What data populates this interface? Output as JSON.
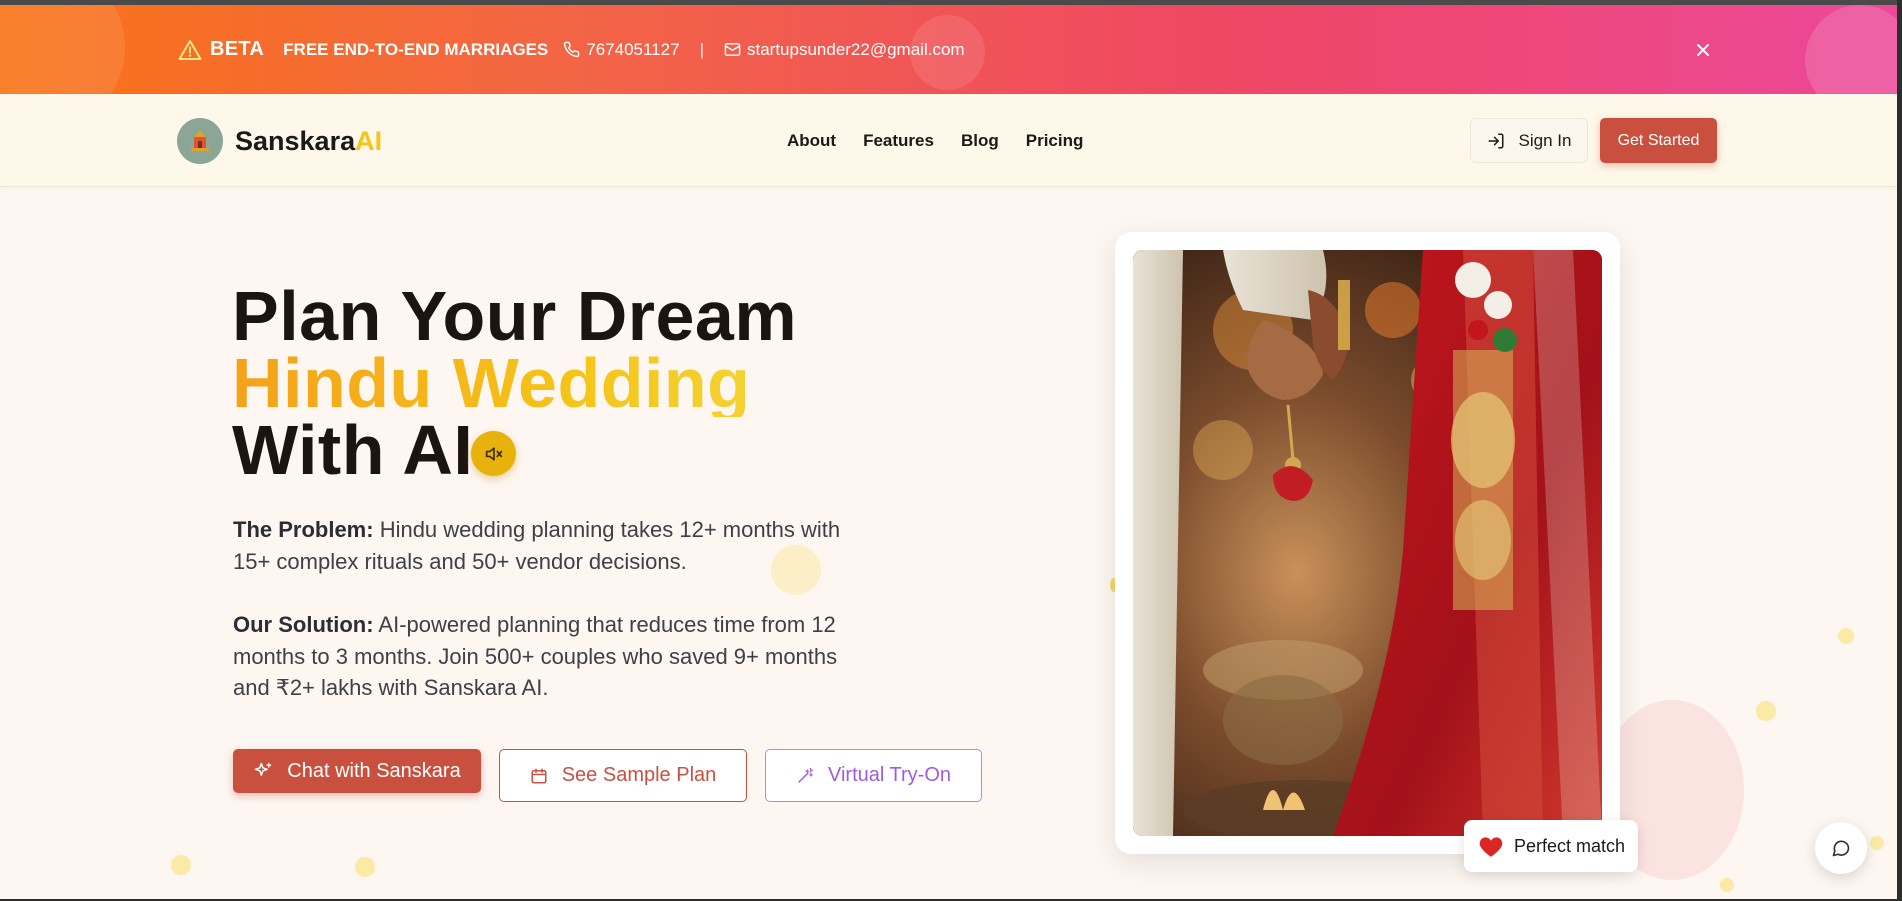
{
  "promo": {
    "beta_label": "BETA",
    "offer": "FREE END-TO-END MARRIAGES",
    "phone": "7674051127",
    "separator": "|",
    "email": "startupsunder22@gmail.com",
    "icons": [
      "warning-icon",
      "phone-icon",
      "mail-icon",
      "close-icon"
    ]
  },
  "header": {
    "brand_main": "Sanskara",
    "brand_accent": "AI",
    "nav": [
      "About",
      "Features",
      "Blog",
      "Pricing"
    ],
    "signin_label": "Sign In",
    "cta_label": "Get Started"
  },
  "hero": {
    "title_line1": "Plan Your Dream",
    "title_line2": "Hindu Wedding",
    "title_line3": "With AI",
    "problem_label": "The Problem:",
    "problem_text": " Hindu wedding planning takes 12+ months with 15+ complex rituals and 50+ vendor decisions.",
    "solution_label": "Our Solution:",
    "solution_text": " AI-powered planning that reduces time from 12 months to 3 months. Join 500+ couples who saved 9+ months and ₹2+ lakhs with Sanskara AI.",
    "btn_chat": "Chat with Sanskara",
    "btn_plan": "See Sample Plan",
    "btn_vto": "Virtual Try-On"
  },
  "badge": {
    "label": "Perfect match"
  },
  "colors": {
    "primary": "#c9503f",
    "gold": "#f5c518",
    "violet": "#a78bfa",
    "promo_start": "#f97316",
    "promo_end": "#ec4899"
  }
}
